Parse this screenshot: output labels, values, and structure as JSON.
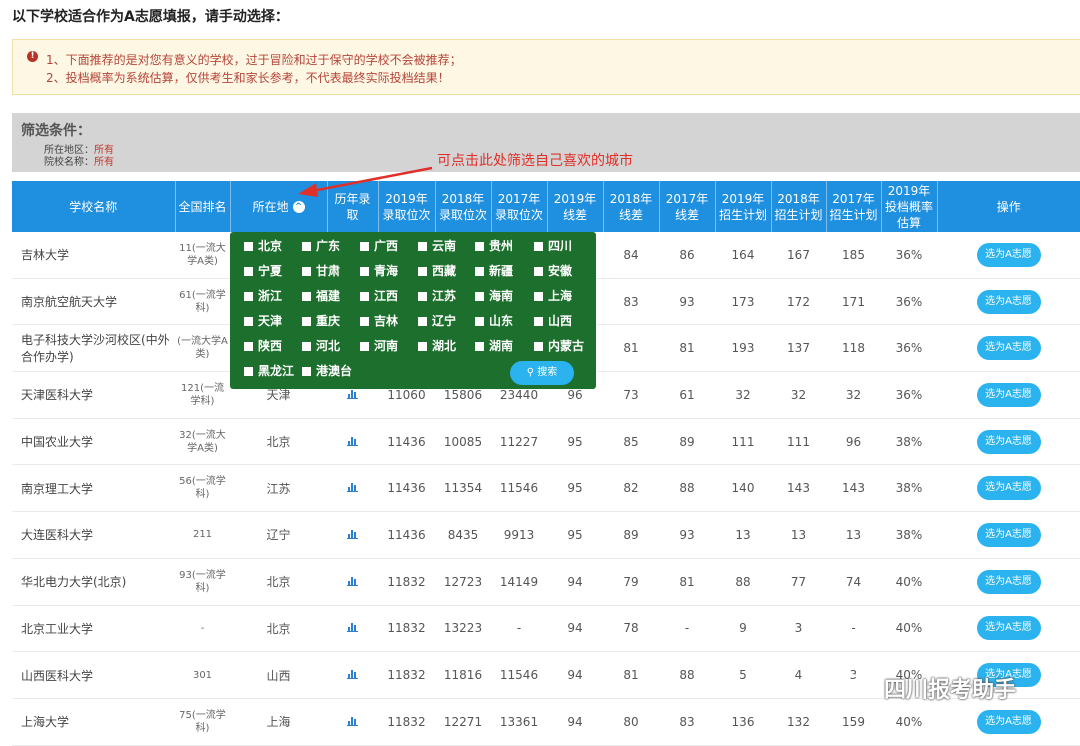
{
  "page_title": "以下学校适合作为A志愿填报，请手动选择：",
  "notice": {
    "line1": "1、下面推荐的是对您有意义的学校，过于冒险和过于保守的学校不会被推荐；",
    "line2": "2、投档概率为系统估算，仅供考生和家长参考，不代表最终实际投档结果！"
  },
  "filter": {
    "title": "筛选条件：",
    "region_label": "所在地区：",
    "region_value": "所有",
    "school_label": "院校名称：",
    "school_value": "所有"
  },
  "annotation": "可点击此处筛选自己喜欢的城市",
  "table": {
    "headers": [
      "学校名称",
      "全国排名",
      "所在地",
      "历年录取",
      "2019年录取位次",
      "2018年录取位次",
      "2017年录取位次",
      "2019年线差",
      "2018年线差",
      "2017年线差",
      "2019年招生计划",
      "2018年招生计划",
      "2017年招生计划",
      "2019年投档概率估算",
      "操作"
    ],
    "action_label": "选为A志愿",
    "rows": [
      {
        "name": "吉林大学",
        "rank": "11(一流大学A类)",
        "loc": "",
        "r19": "",
        "r18": "",
        "r17": "",
        "d19": "",
        "d18": "84",
        "d17": "86",
        "p19": "164",
        "p18": "167",
        "p17": "185",
        "prob": "36%"
      },
      {
        "name": "南京航空航天大学",
        "rank": "61(一流学科)",
        "loc": "",
        "r19": "",
        "r18": "",
        "r17": "",
        "d19": "",
        "d18": "83",
        "d17": "93",
        "p19": "173",
        "p18": "172",
        "p17": "171",
        "prob": "36%"
      },
      {
        "name": "电子科技大学沙河校区(中外合作办学)",
        "rank": "(一流大学A类)",
        "loc": "",
        "r19": "",
        "r18": "",
        "r17": "",
        "d19": "",
        "d18": "81",
        "d17": "81",
        "p19": "193",
        "p18": "137",
        "p17": "118",
        "prob": "36%"
      },
      {
        "name": "天津医科大学",
        "rank": "121(一流学科)",
        "loc": "天津",
        "r19": "11060",
        "r18": "15806",
        "r17": "23440",
        "d19": "96",
        "d18": "73",
        "d17": "61",
        "p19": "32",
        "p18": "32",
        "p17": "32",
        "prob": "36%"
      },
      {
        "name": "中国农业大学",
        "rank": "32(一流大学A类)",
        "loc": "北京",
        "r19": "11436",
        "r18": "10085",
        "r17": "11227",
        "d19": "95",
        "d18": "85",
        "d17": "89",
        "p19": "111",
        "p18": "111",
        "p17": "96",
        "prob": "38%"
      },
      {
        "name": "南京理工大学",
        "rank": "56(一流学科)",
        "loc": "江苏",
        "r19": "11436",
        "r18": "11354",
        "r17": "11546",
        "d19": "95",
        "d18": "82",
        "d17": "88",
        "p19": "140",
        "p18": "143",
        "p17": "143",
        "prob": "38%"
      },
      {
        "name": "大连医科大学",
        "rank": "211",
        "loc": "辽宁",
        "r19": "11436",
        "r18": "8435",
        "r17": "9913",
        "d19": "95",
        "d18": "89",
        "d17": "93",
        "p19": "13",
        "p18": "13",
        "p17": "13",
        "prob": "38%"
      },
      {
        "name": "华北电力大学(北京)",
        "rank": "93(一流学科)",
        "loc": "北京",
        "r19": "11832",
        "r18": "12723",
        "r17": "14149",
        "d19": "94",
        "d18": "79",
        "d17": "81",
        "p19": "88",
        "p18": "77",
        "p17": "74",
        "prob": "40%"
      },
      {
        "name": "北京工业大学",
        "rank": "-",
        "loc": "北京",
        "r19": "11832",
        "r18": "13223",
        "r17": "-",
        "d19": "94",
        "d18": "78",
        "d17": "-",
        "p19": "9",
        "p18": "3",
        "p17": "-",
        "prob": "40%"
      },
      {
        "name": "山西医科大学",
        "rank": "301",
        "loc": "山西",
        "r19": "11832",
        "r18": "11816",
        "r17": "11546",
        "d19": "94",
        "d18": "81",
        "d17": "88",
        "p19": "5",
        "p18": "4",
        "p17": "3",
        "prob": "40%"
      },
      {
        "name": "上海大学",
        "rank": "75(一流学科)",
        "loc": "上海",
        "r19": "11832",
        "r18": "12271",
        "r17": "13361",
        "d19": "94",
        "d18": "80",
        "d17": "83",
        "p19": "136",
        "p18": "132",
        "p17": "159",
        "prob": "40%"
      }
    ]
  },
  "city_popup": {
    "cities": [
      "北京",
      "广东",
      "广西",
      "云南",
      "贵州",
      "四川",
      "宁夏",
      "甘肃",
      "青海",
      "西藏",
      "新疆",
      "安徽",
      "浙江",
      "福建",
      "江西",
      "江苏",
      "海南",
      "上海",
      "天津",
      "重庆",
      "吉林",
      "辽宁",
      "山东",
      "山西",
      "陕西",
      "河北",
      "河南",
      "湖北",
      "湖南",
      "内蒙古",
      "黑龙江",
      "港澳台"
    ],
    "search_label": "搜索"
  },
  "watermark": "四川报考助手",
  "colors": {
    "header_blue": "#1f8fe0",
    "button_blue": "#2ab3ef",
    "popup_green": "#1d6f2d",
    "annotation_red": "#e0302a"
  }
}
